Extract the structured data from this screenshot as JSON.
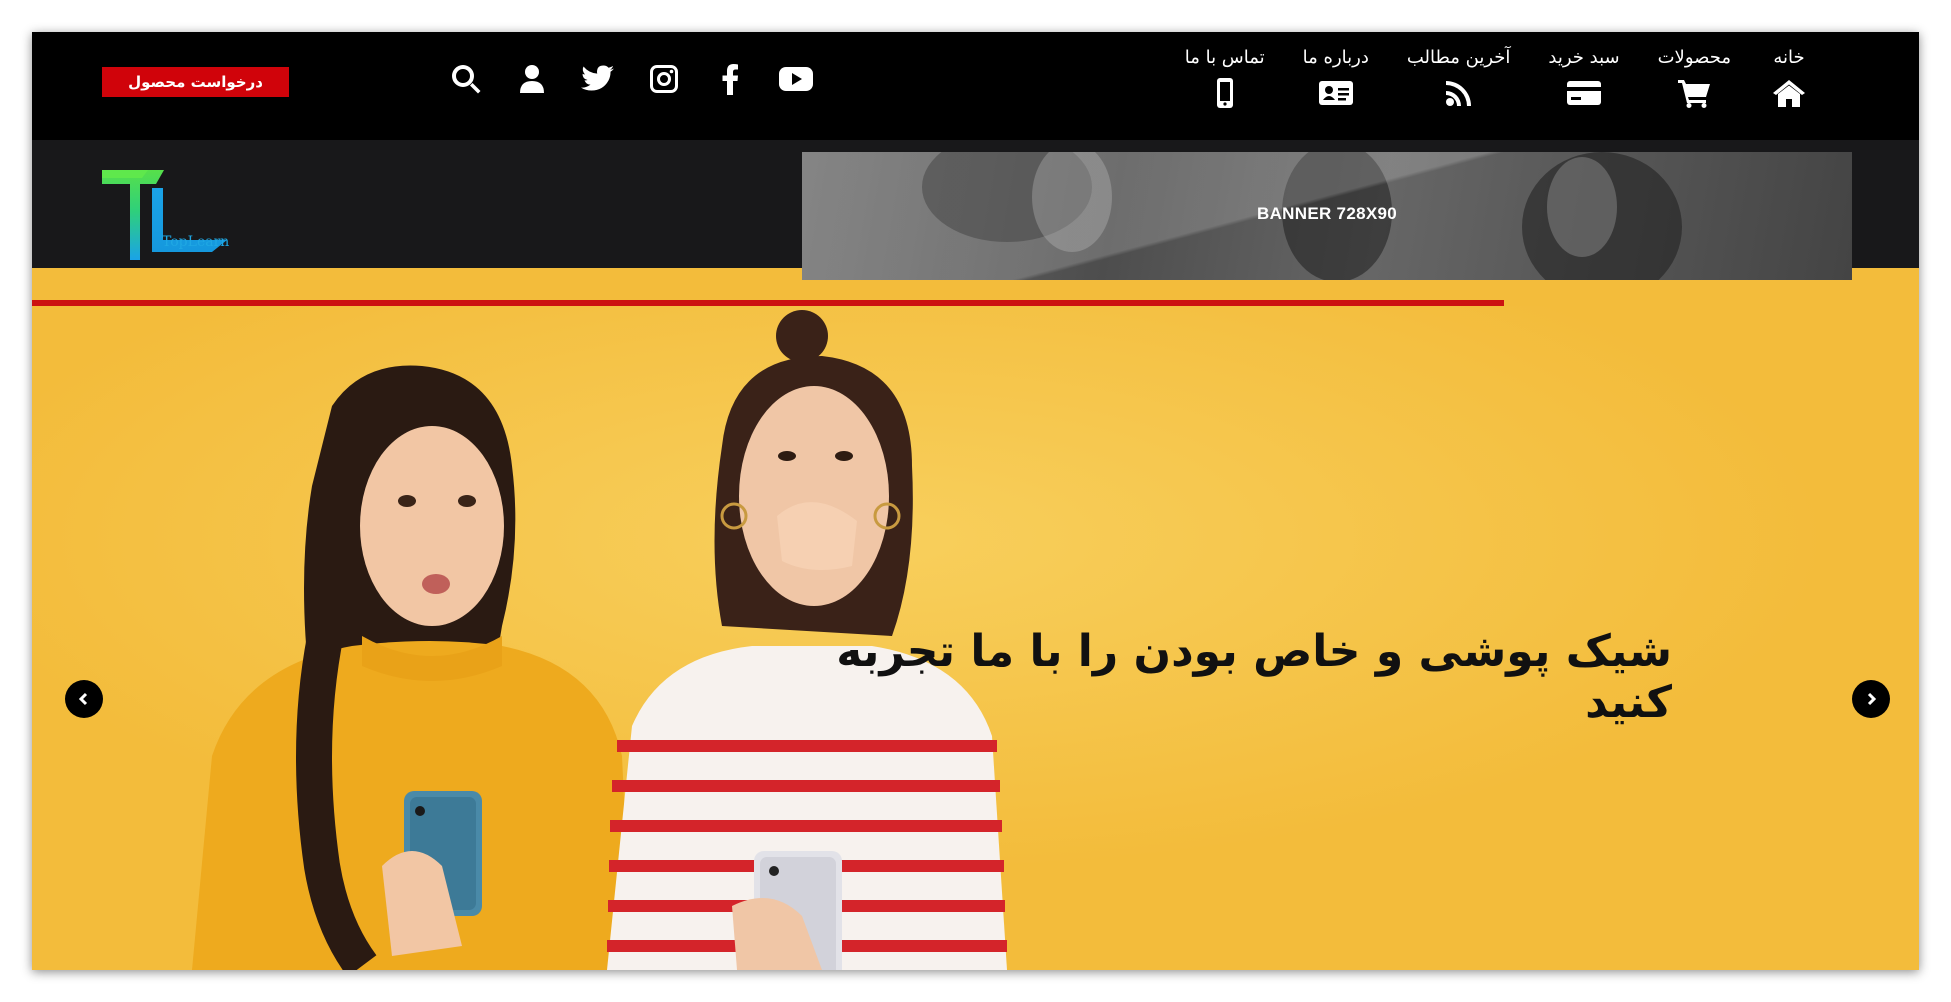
{
  "nav": {
    "items": [
      {
        "label": "خانه",
        "icon": "home-icon"
      },
      {
        "label": "محصولات",
        "icon": "cart-icon"
      },
      {
        "label": "سبد خرید",
        "icon": "credit-card-icon"
      },
      {
        "label": "آخرین مطالب",
        "icon": "rss-icon"
      },
      {
        "label": "درباره ما",
        "icon": "id-card-icon"
      },
      {
        "label": "تماس با ما",
        "icon": "mobile-phone-icon"
      }
    ]
  },
  "social": [
    "youtube-icon",
    "facebook-icon",
    "instagram-icon",
    "twitter-icon",
    "user-icon",
    "search-icon"
  ],
  "request_button": {
    "label": "درخواست محصول",
    "color": "#d0030a"
  },
  "logo": {
    "text": "TopLearn"
  },
  "banner": {
    "label": "BANNER 728X90"
  },
  "slider": {
    "progress": 0.78,
    "progress_color": "#cc1111"
  },
  "hero": {
    "title": "شیک پوشی و خاص بودن را با ما تجربه کنید",
    "background": "#f3bc3b"
  }
}
